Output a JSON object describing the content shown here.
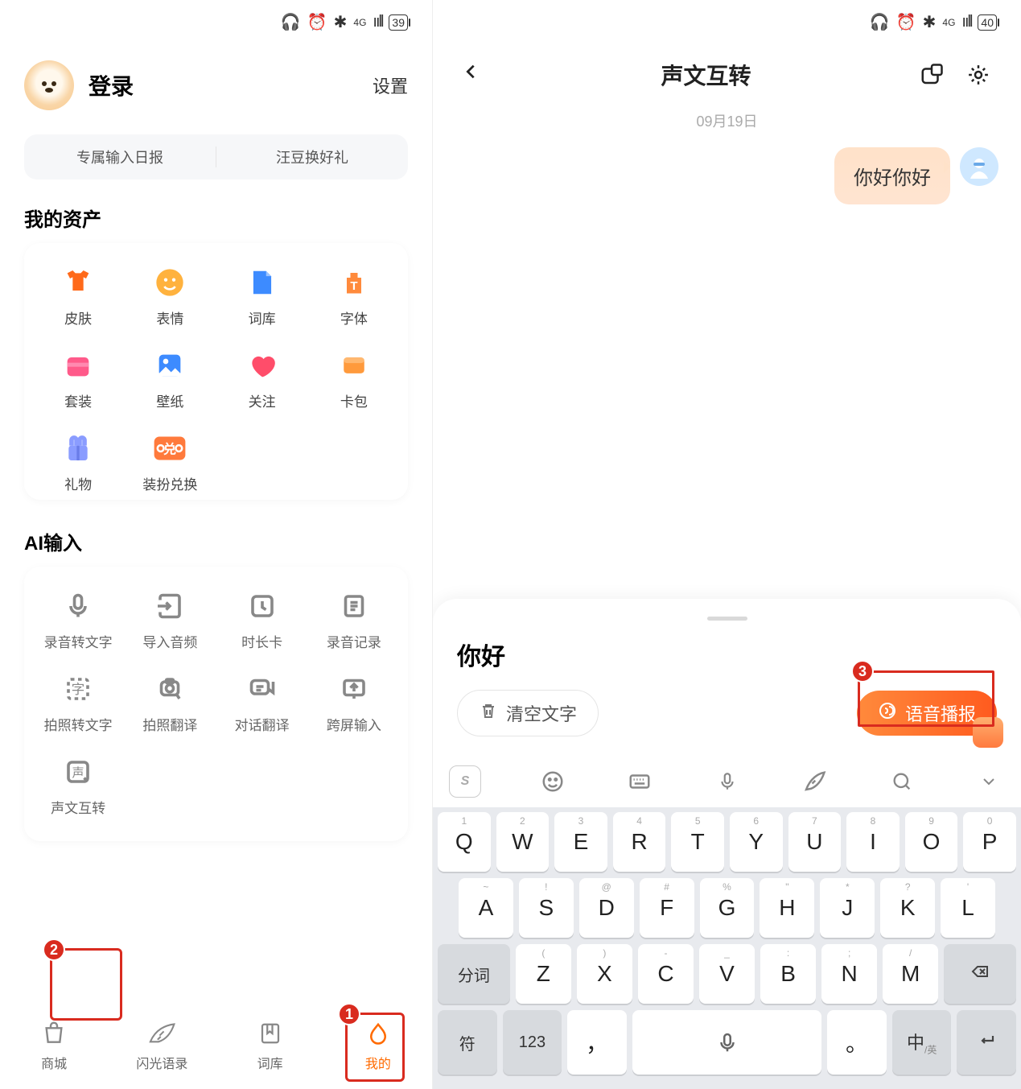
{
  "left": {
    "status": {
      "signal": "ᯤ",
      "battery": "39"
    },
    "login": "登录",
    "settings": "设置",
    "banner": {
      "a": "专属输入日报",
      "b": "汪豆换好礼"
    },
    "assets_title": "我的资产",
    "assets": [
      {
        "label": "皮肤"
      },
      {
        "label": "表情"
      },
      {
        "label": "词库"
      },
      {
        "label": "字体"
      },
      {
        "label": "套装"
      },
      {
        "label": "壁纸"
      },
      {
        "label": "关注"
      },
      {
        "label": "卡包"
      },
      {
        "label": "礼物"
      },
      {
        "label": "装扮兑换"
      }
    ],
    "ai_title": "AI输入",
    "ai": [
      {
        "label": "录音转文字"
      },
      {
        "label": "导入音频"
      },
      {
        "label": "时长卡"
      },
      {
        "label": "录音记录"
      },
      {
        "label": "拍照转文字"
      },
      {
        "label": "拍照翻译"
      },
      {
        "label": "对话翻译"
      },
      {
        "label": "跨屏输入"
      },
      {
        "label": "声文互转"
      }
    ],
    "tabs": [
      {
        "label": "商城"
      },
      {
        "label": "闪光语录"
      },
      {
        "label": "词库"
      },
      {
        "label": "我的"
      }
    ],
    "callouts": {
      "one": "1",
      "two": "2"
    }
  },
  "right": {
    "status": {
      "battery": "40"
    },
    "title": "声文互转",
    "date": "09月19日",
    "message": "你好你好",
    "sheet": {
      "title": "你好",
      "clear": "清空文字",
      "play": "语音播报"
    },
    "callouts": {
      "three": "3"
    },
    "keyboard": {
      "row1": [
        {
          "sup": "1",
          "main": "Q"
        },
        {
          "sup": "2",
          "main": "W"
        },
        {
          "sup": "3",
          "main": "E"
        },
        {
          "sup": "4",
          "main": "R"
        },
        {
          "sup": "5",
          "main": "T"
        },
        {
          "sup": "6",
          "main": "Y"
        },
        {
          "sup": "7",
          "main": "U"
        },
        {
          "sup": "8",
          "main": "I"
        },
        {
          "sup": "9",
          "main": "O"
        },
        {
          "sup": "0",
          "main": "P"
        }
      ],
      "row2": [
        {
          "sup": "~",
          "main": "A"
        },
        {
          "sup": "!",
          "main": "S"
        },
        {
          "sup": "@",
          "main": "D"
        },
        {
          "sup": "#",
          "main": "F"
        },
        {
          "sup": "%",
          "main": "G"
        },
        {
          "sup": "\"",
          "main": "H"
        },
        {
          "sup": "*",
          "main": "J"
        },
        {
          "sup": "?",
          "main": "K"
        },
        {
          "sup": "'",
          "main": "L"
        }
      ],
      "row3_fn": "分词",
      "row3": [
        {
          "sup": "(",
          "main": "Z"
        },
        {
          "sup": ")",
          "main": "X"
        },
        {
          "sup": "-",
          "main": "C"
        },
        {
          "sup": "_",
          "main": "V"
        },
        {
          "sup": ":",
          "main": "B"
        },
        {
          "sup": ";",
          "main": "N"
        },
        {
          "sup": "/",
          "main": "M"
        }
      ],
      "bottom": {
        "sym": "符",
        "num": "123",
        "comma": "，",
        "period": "。",
        "cnen_cn": "中",
        "cnen_en": "英"
      }
    }
  }
}
